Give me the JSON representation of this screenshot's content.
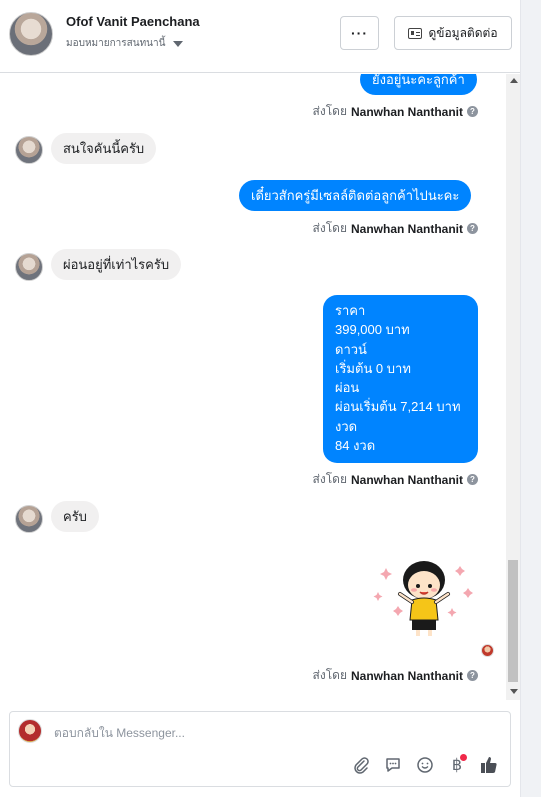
{
  "header": {
    "name": "Ofof Vanit Paenchana",
    "assign_label": "มอบหมายการสนทนานี้",
    "more_label": "···",
    "contact_label": "ดูข้อมูลติดต่อ"
  },
  "messages": {
    "m1_text": "ยังอยู่นะคะลูกค้า",
    "sent_prefix": "ส่งโดย",
    "sender": "Nanwhan Nanthanit",
    "in1_text": "สนใจคันนี้ครับ",
    "m2_text": "เดี๋ยวสักครู่มีเซลล์ติดต่อลูกค้าไปนะคะ",
    "in2_text": "ผ่อนอยู่ที่เท่าไรครับ",
    "m3_text": "ราคา\n399,000 บาท\nดาวน์\nเริ่มต้น 0 บาท\nผ่อน\nผ่อนเริ่มต้น 7,214 บาท\nงวด\n84 งวด",
    "in3_text": "ครับ"
  },
  "composer": {
    "placeholder": "ตอบกลับใน Messenger..."
  },
  "icons": {
    "attach": "paperclip-icon",
    "saved_reply": "speech-bubble-icon",
    "emoji": "smiley-icon",
    "payment": "baht-icon",
    "like": "thumbs-up-icon"
  },
  "colors": {
    "outgoing_bubble": "#0084ff",
    "incoming_bubble": "#f1f0f0",
    "notification_dot": "#f02849"
  }
}
